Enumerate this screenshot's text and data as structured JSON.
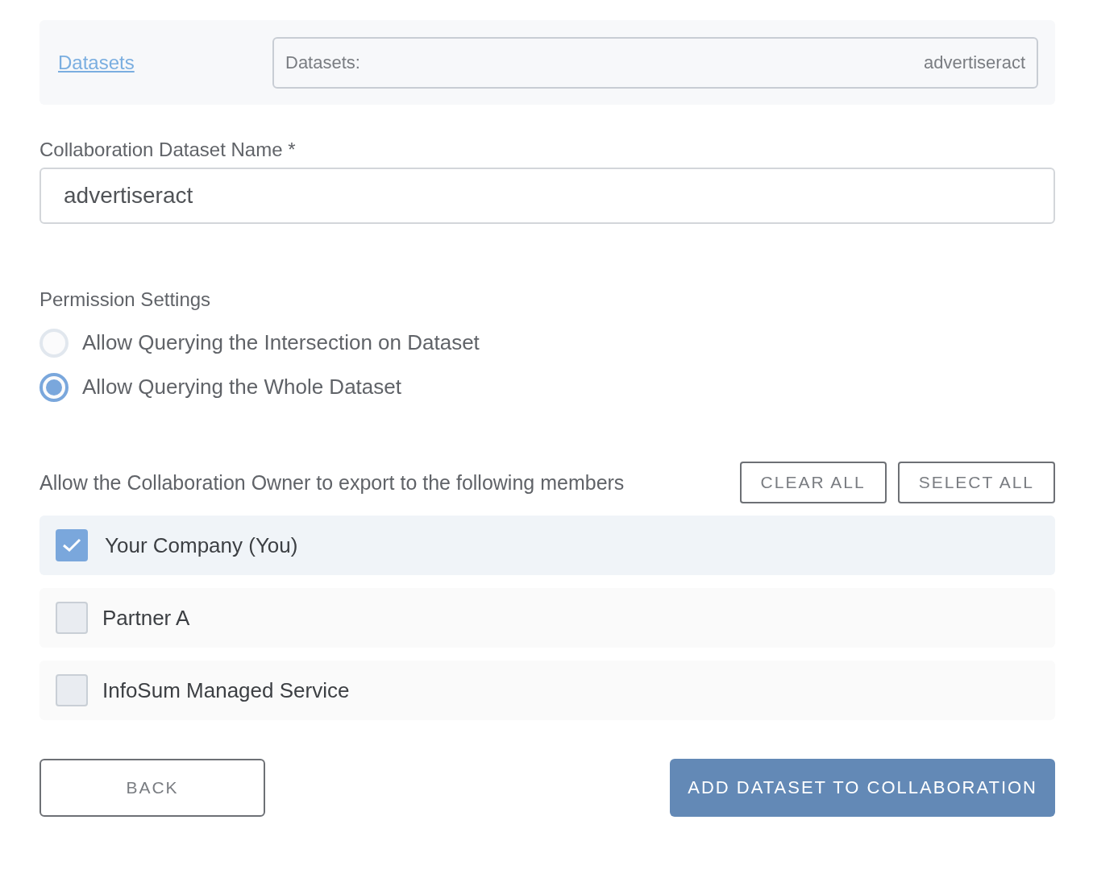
{
  "dataset_link": {
    "label": "Datasets"
  },
  "dataset_summary": {
    "label": "Datasets:",
    "value": "advertiseract"
  },
  "name_field": {
    "label": "Collaboration Dataset Name *",
    "value": "advertiseract"
  },
  "permissions": {
    "heading": "Permission Settings",
    "options": [
      {
        "label": "Allow Querying the Intersection on Dataset",
        "selected": false
      },
      {
        "label": "Allow Querying the Whole Dataset",
        "selected": true
      }
    ]
  },
  "members": {
    "heading": "Allow the Collaboration Owner to export to the following members",
    "buttons": [
      "CLEAR ALL",
      "SELECT ALL"
    ],
    "items": [
      {
        "label": "Your Company (You)",
        "checked": true
      },
      {
        "label": "Partner A",
        "checked": false
      },
      {
        "label": "InfoSum Managed Service",
        "checked": false
      }
    ]
  },
  "back_button": "BACK",
  "submit_button": "ADD DATASET TO COLLABORATION"
}
